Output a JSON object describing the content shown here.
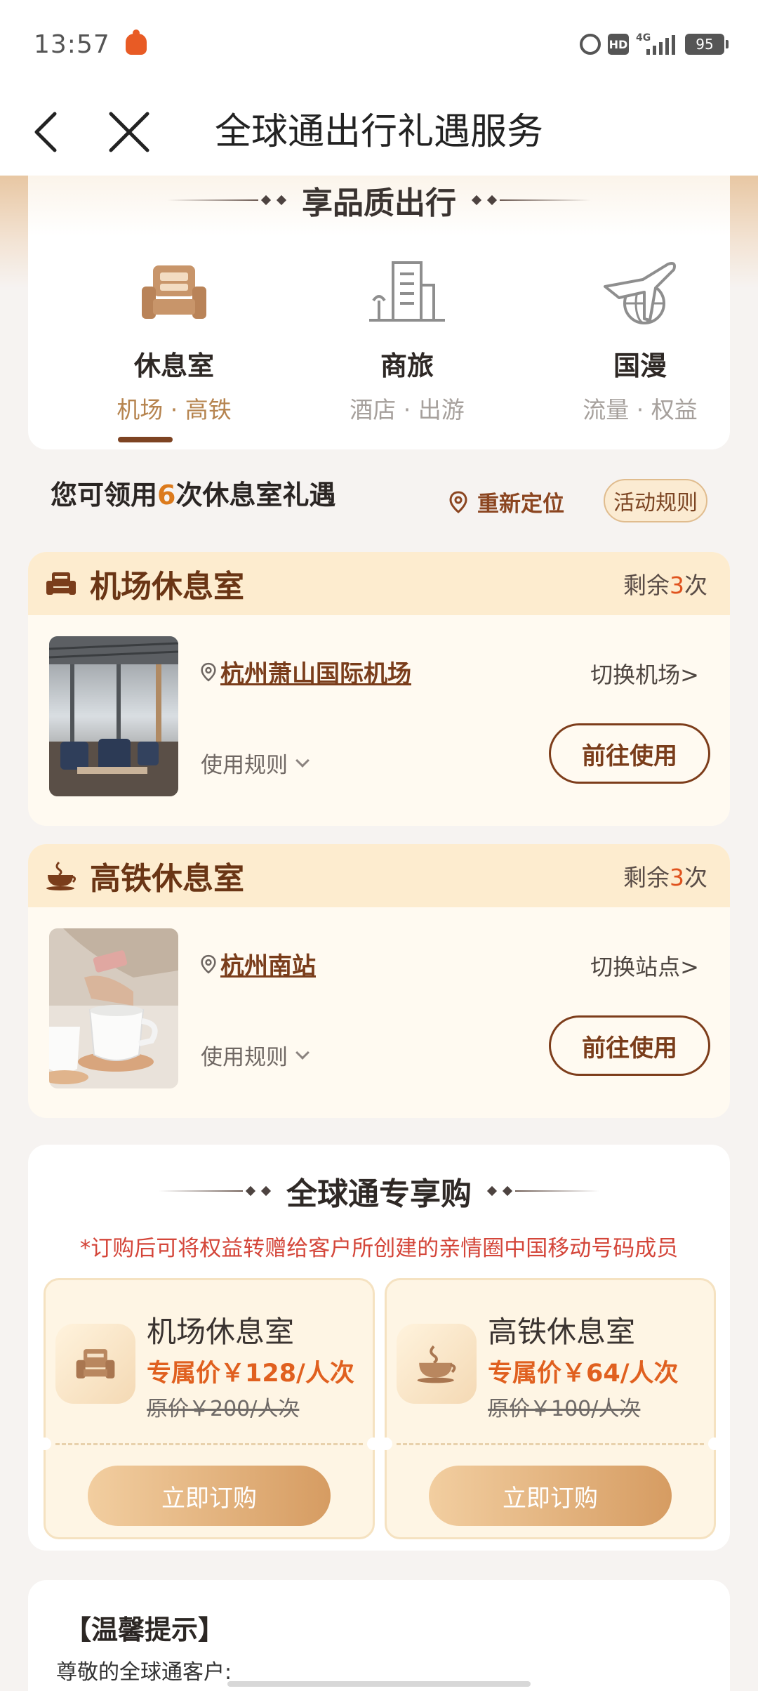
{
  "status_bar": {
    "time": "13:57",
    "hd_label": "HD",
    "network_label": "4G",
    "battery": "95",
    "icons": [
      "app-notification-icon",
      "alarm-icon",
      "hd-icon",
      "signal-icon",
      "battery-icon"
    ]
  },
  "nav": {
    "title": "全球通出行礼遇服务",
    "icons": [
      "back-arrow-icon",
      "close-icon"
    ]
  },
  "services": {
    "title": "享品质出行",
    "items": [
      {
        "name": "休息室",
        "sub": "机场 · 高铁",
        "icon": "lounge-sofa-icon",
        "active": true
      },
      {
        "name": "商旅",
        "sub": "酒店 · 出游",
        "icon": "city-building-icon",
        "active": false
      },
      {
        "name": "国漫",
        "sub": "流量 · 权益",
        "icon": "plane-globe-icon",
        "active": false
      }
    ]
  },
  "benefit": {
    "prefix": "您可领用",
    "count": "6",
    "suffix": "次休息室礼遇",
    "relocate": "重新定位",
    "rules": "活动规则"
  },
  "airport_lounge": {
    "title": "机场休息室",
    "remaining_prefix": "剩余",
    "remaining_count": "3",
    "remaining_suffix": "次",
    "location": "杭州萧山国际机场",
    "switch": "切换机场>",
    "usage_rules": "使用规则",
    "go": "前往使用"
  },
  "rail_lounge": {
    "title": "高铁休息室",
    "remaining_prefix": "剩余",
    "remaining_count": "3",
    "remaining_suffix": "次",
    "location": "杭州南站",
    "switch": "切换站点>",
    "usage_rules": "使用规则",
    "go": "前往使用"
  },
  "shop": {
    "title": "全球通专享购",
    "note": "*订购后可将权益转赠给客户所创建的亲情圈中国移动号码成员",
    "offers": [
      {
        "name": "机场休息室",
        "price": "专属价￥128/人次",
        "original": "原价￥200/人次",
        "button": "立即订购",
        "icon": "lounge-sofa-icon"
      },
      {
        "name": "高铁休息室",
        "price": "专属价￥64/人次",
        "original": "原价￥100/人次",
        "button": "立即订购",
        "icon": "coffee-cup-icon"
      }
    ]
  },
  "tips": {
    "title": "【温馨提示】",
    "greeting": "尊敬的全球通客户:"
  },
  "colors": {
    "accent_brown": "#7a3d1b",
    "accent_orange": "#e0601f",
    "card_header": "#fdeccf",
    "note_red": "#d4463a"
  }
}
